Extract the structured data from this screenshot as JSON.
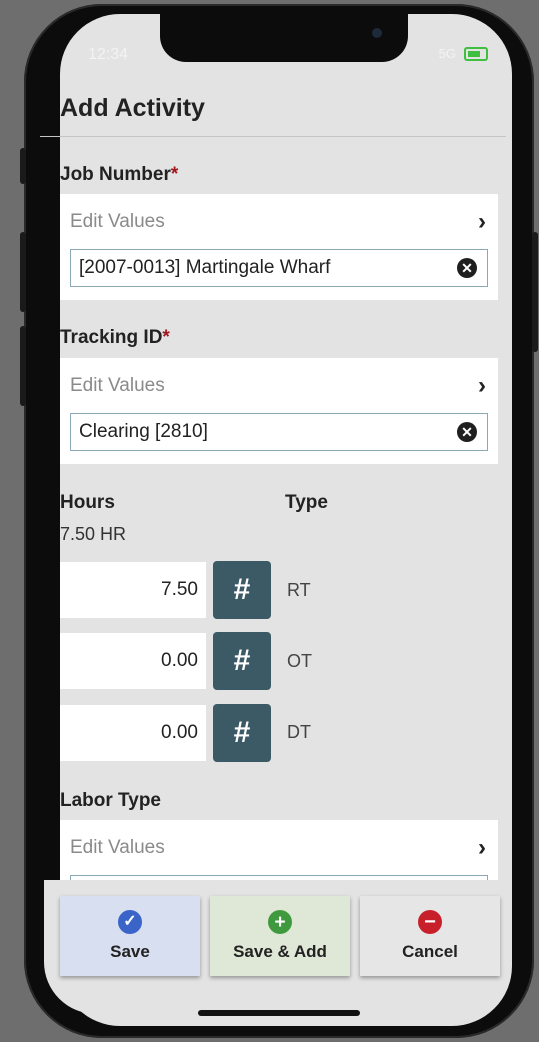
{
  "status_bar": {
    "time": "12:34",
    "signal": "5G"
  },
  "header": {
    "title": "Add Activity"
  },
  "job_number": {
    "label": "Job Number",
    "required_mark": "*",
    "edit_label": "Edit Values",
    "value": "[2007-0013] Martingale Wharf"
  },
  "tracking_id": {
    "label": "Tracking ID",
    "required_mark": "*",
    "edit_label": "Edit Values",
    "value": "Clearing [2810]"
  },
  "hours": {
    "label": "Hours",
    "type_label": "Type",
    "total": "7.50 HR",
    "rows": [
      {
        "value": "7.50",
        "button": "#",
        "type": "RT"
      },
      {
        "value": "0.00",
        "button": "#",
        "type": "OT"
      },
      {
        "value": "0.00",
        "button": "#",
        "type": "DT"
      }
    ]
  },
  "labor_type": {
    "label": "Labor Type",
    "edit_label": "Edit Values"
  },
  "actions": {
    "save": {
      "label": "Save",
      "icon": "check-circle-icon",
      "bg": "#d8dff0",
      "icon_color": "#3a64c8"
    },
    "save_add": {
      "label": "Save & Add",
      "icon": "plus-circle-icon",
      "bg": "#dfe8d6",
      "icon_color": "#3f9a3f"
    },
    "cancel": {
      "label": "Cancel",
      "icon": "minus-circle-icon",
      "bg": "#e6e6e6",
      "icon_color": "#c8202a"
    }
  }
}
